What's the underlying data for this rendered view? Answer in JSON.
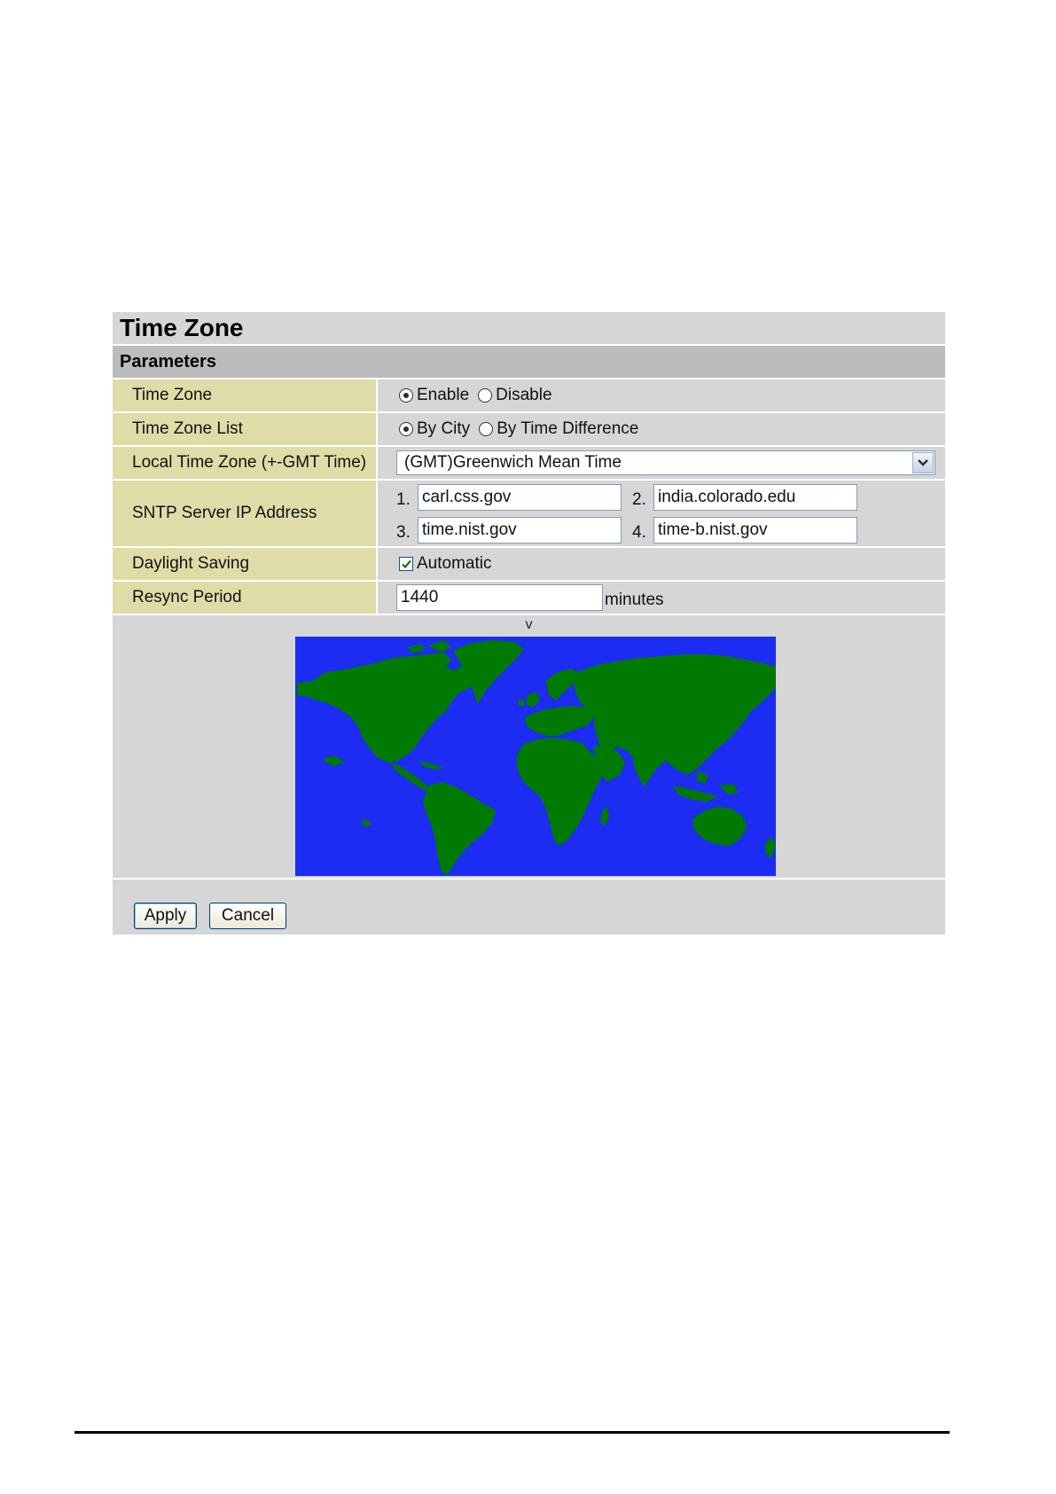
{
  "header": {
    "title": "Time Zone",
    "section": "Parameters"
  },
  "rows": {
    "time_zone": {
      "label": "Time Zone",
      "options": [
        {
          "label": "Enable",
          "selected": true
        },
        {
          "label": "Disable",
          "selected": false
        }
      ]
    },
    "time_zone_list": {
      "label": "Time Zone List",
      "options": [
        {
          "label": "By City",
          "selected": true
        },
        {
          "label": "By Time Difference",
          "selected": false
        }
      ]
    },
    "local_time_zone": {
      "label": "Local Time Zone (+-GMT Time)",
      "value": "(GMT)Greenwich Mean Time"
    },
    "sntp": {
      "label": "SNTP Server IP Address",
      "servers": [
        {
          "num": "1.",
          "value": "carl.css.gov"
        },
        {
          "num": "2.",
          "value": "india.colorado.edu"
        },
        {
          "num": "3.",
          "value": "time.nist.gov"
        },
        {
          "num": "4.",
          "value": "time-b.nist.gov"
        }
      ]
    },
    "daylight_saving": {
      "label": "Daylight Saving",
      "option": "Automatic",
      "checked": true
    },
    "resync": {
      "label": "Resync Period",
      "value": "1440",
      "unit": "minutes"
    }
  },
  "map": {
    "marker": "v",
    "ocean_color": "#1c2cf2",
    "land_color": "#007a00"
  },
  "buttons": {
    "apply": "Apply",
    "cancel": "Cancel"
  },
  "icons": {
    "select_arrow": "chevron-down-icon",
    "checkbox_mark": "check-icon"
  }
}
